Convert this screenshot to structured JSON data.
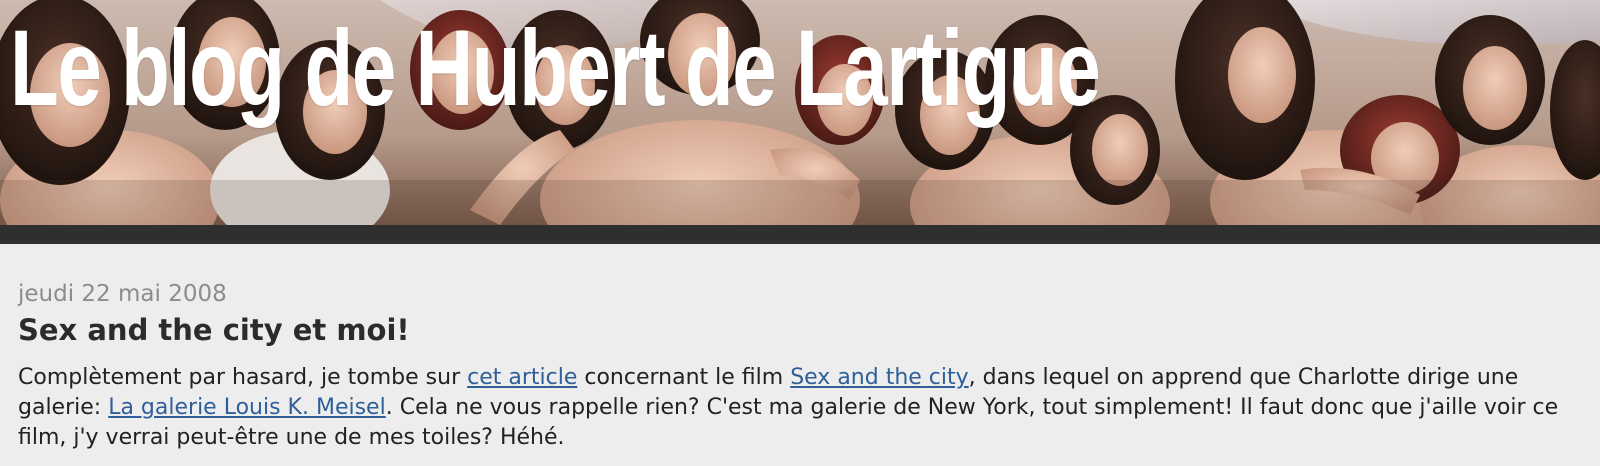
{
  "header": {
    "blog_title": "Le blog de Hubert de Lartigue",
    "banner_image": "painting of a group of women"
  },
  "post": {
    "date": "jeudi 22 mai 2008",
    "title": "Sex and the city et moi!",
    "body": {
      "text_1": "Complètement par hasard, je tombe sur ",
      "link_1": "cet article",
      "text_2": " concernant le film ",
      "link_2": "Sex and the city",
      "text_3": ", dans lequel on apprend que Charlotte dirige une galerie: ",
      "link_3": "La galerie Louis K. Meisel",
      "text_4": ". Cela ne vous rappelle rien? C'est ma galerie de New York, tout simplement! Il faut donc que j'aille voir ce film, j'y verrai peut-être une de mes toiles? Héhé."
    }
  },
  "colors": {
    "page_background": "#ededed",
    "header_bar": "#2f2f2f",
    "link": "#2f5f99",
    "date_text": "#8c8c8c",
    "title_text": "#2b2b2b"
  }
}
